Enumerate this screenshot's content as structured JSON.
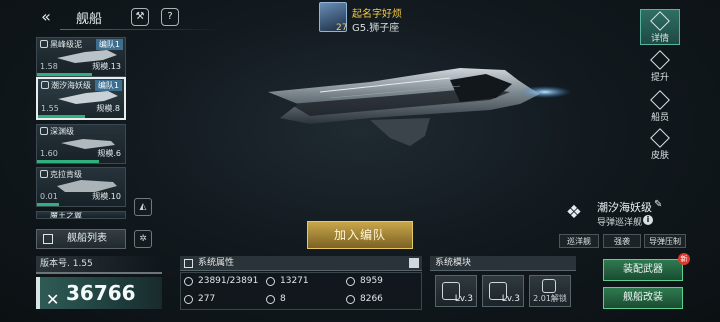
{
  "header": {
    "title": "舰船"
  },
  "player": {
    "level": "27",
    "name": "起名字好烦",
    "rank": "G5.狮子座"
  },
  "ship_list": [
    {
      "name": "黑峰级泥",
      "tag": "编队1",
      "rating": "1.58",
      "scale": "规模.13",
      "progress": 0.62
    },
    {
      "name": "潮汐海妖级",
      "tag": "编队1",
      "rating": "1.55",
      "scale": "规模.8",
      "progress": 0.55
    },
    {
      "name": "深渊级",
      "tag": "",
      "rating": "1.60",
      "scale": "规模.6",
      "progress": 0.7
    },
    {
      "name": "克拉肯级",
      "tag": "",
      "rating": "0.01",
      "scale": "规模.10",
      "progress": 0.25
    },
    {
      "name": "魔王之翼",
      "tag": "",
      "rating": "",
      "scale": "",
      "progress": 0.1
    }
  ],
  "list_button": "舰船列表",
  "join_button": "加入编队",
  "version": "版本号. 1.55",
  "power": "36766",
  "attributes": {
    "title": "系统属性",
    "cells": [
      "23891/23891",
      "13271",
      "8959",
      "277",
      "8",
      "8266"
    ]
  },
  "modules": {
    "title": "系统模块",
    "items": [
      {
        "level": "Lv.3"
      },
      {
        "level": "Lv.3"
      },
      {
        "level": "2.01解锁"
      }
    ]
  },
  "right_tabs": [
    "详情",
    "提升",
    "船员",
    "皮肤"
  ],
  "selected_ship": {
    "name": "潮汐海妖级",
    "type": "导弹巡洋舰",
    "chips": [
      "巡洋舰",
      "强袭",
      "导弹压制"
    ]
  },
  "actions": {
    "equip": "装配武器",
    "modify": "舰船改装",
    "new_badge": "新"
  },
  "colors": {
    "accent": "#2fb07d",
    "gold": "#c8a64a",
    "tab_active": "#2f6f64"
  }
}
